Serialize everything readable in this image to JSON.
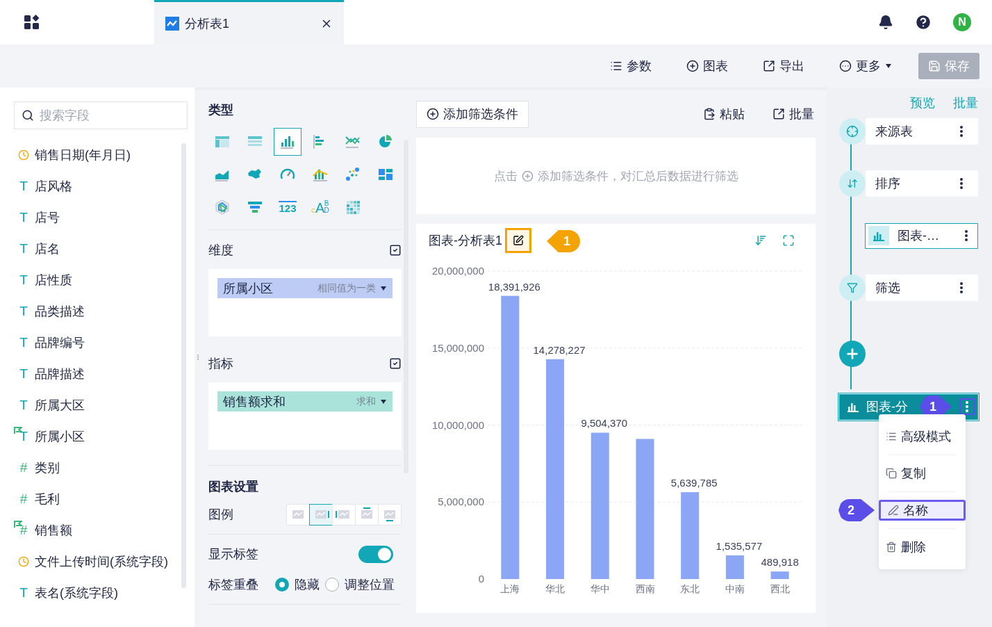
{
  "header": {
    "tab": {
      "title": "分析表1",
      "selected": true
    },
    "user_initial": "N"
  },
  "toolbar": {
    "buttons": [
      {
        "kind": "param",
        "label": "参数"
      },
      {
        "kind": "chart",
        "label": "图表"
      },
      {
        "kind": "export",
        "label": "导出"
      },
      {
        "kind": "more",
        "label": "更多"
      }
    ],
    "save": {
      "label": "保存",
      "disabled": true
    }
  },
  "fields": {
    "search_placeholder": "搜索字段",
    "items": [
      {
        "kind": "date",
        "name": "销售日期(年月日)",
        "flagged": false
      },
      {
        "kind": "text",
        "glyph": "T",
        "name": "店风格",
        "flagged": false
      },
      {
        "kind": "text",
        "glyph": "T",
        "name": "店号",
        "flagged": false
      },
      {
        "kind": "text",
        "glyph": "T",
        "name": "店名",
        "flagged": false
      },
      {
        "kind": "text",
        "glyph": "T",
        "name": "店性质",
        "flagged": false
      },
      {
        "kind": "text",
        "glyph": "T",
        "name": "品类描述",
        "flagged": false
      },
      {
        "kind": "text",
        "glyph": "T",
        "name": "品牌编号",
        "flagged": false
      },
      {
        "kind": "text",
        "glyph": "T",
        "name": "品牌描述",
        "flagged": false
      },
      {
        "kind": "text",
        "glyph": "T",
        "name": "所属大区",
        "flagged": false
      },
      {
        "kind": "text",
        "glyph": "T",
        "name": "所属小区",
        "flagged": true
      },
      {
        "kind": "number",
        "glyph": "#",
        "name": "类别",
        "flagged": false
      },
      {
        "kind": "number",
        "glyph": "#",
        "name": "毛利",
        "flagged": false
      },
      {
        "kind": "number",
        "glyph": "#",
        "name": "销售额",
        "flagged": true
      },
      {
        "kind": "date",
        "name": "文件上传时间(系统字段)",
        "flagged": false
      },
      {
        "kind": "text",
        "glyph": "T",
        "name": "表名(系统字段)",
        "flagged": false
      }
    ]
  },
  "config": {
    "type_title": "类型",
    "chart_types": [
      {
        "kind": "crosstab",
        "selected": false
      },
      {
        "kind": "table",
        "selected": false
      },
      {
        "kind": "bar",
        "selected": true
      },
      {
        "kind": "hbar",
        "selected": false
      },
      {
        "kind": "line",
        "selected": false
      },
      {
        "kind": "pie",
        "selected": false
      },
      {
        "kind": "area",
        "selected": false
      },
      {
        "kind": "map",
        "selected": false
      },
      {
        "kind": "gauge",
        "selected": false
      },
      {
        "kind": "combo",
        "selected": false
      },
      {
        "kind": "scatter",
        "selected": false
      },
      {
        "kind": "tiles",
        "selected": false
      },
      {
        "kind": "radar",
        "selected": false
      },
      {
        "kind": "funnel",
        "selected": false
      },
      {
        "kind": "number",
        "glyph": "123",
        "selected": false
      },
      {
        "kind": "wordcloud",
        "glyphs": [
          "C",
          "A",
          "B",
          "D"
        ],
        "selected": false
      },
      {
        "kind": "heatmap",
        "selected": false
      }
    ],
    "dimension": {
      "title": "维度",
      "fields": [
        {
          "name": "所属小区",
          "note": "相同值为一类"
        }
      ]
    },
    "measure": {
      "title": "指标",
      "fields": [
        {
          "name": "销售额求和",
          "note": "求和"
        }
      ]
    },
    "settings": {
      "title": "图表设置",
      "legend": {
        "label": "图例",
        "options": [
          {
            "kind": "none",
            "selected": false
          },
          {
            "kind": "right",
            "selected": true
          },
          {
            "kind": "left",
            "selected": false
          },
          {
            "kind": "top",
            "selected": false
          },
          {
            "kind": "bottom",
            "selected": false
          }
        ]
      },
      "show_labels": {
        "label": "显示标签",
        "on": true
      },
      "overlap": {
        "label": "标签重叠",
        "options": [
          {
            "label": "隐藏",
            "selected": true
          },
          {
            "label": "调整位置",
            "selected": false
          }
        ]
      }
    }
  },
  "filter": {
    "add": "添加筛选条件",
    "paste": "粘贴",
    "batch": "批量",
    "hint_before": "点击",
    "hint_link": "添加筛选条件，对汇总后数据进行筛选"
  },
  "chart": {
    "title": "图表-分析表1",
    "callout": "1",
    "chart_data": {
      "type": "bar",
      "categories": [
        "上海",
        "华北",
        "华中",
        "西南",
        "东北",
        "中南",
        "西北"
      ],
      "values": [
        18391926,
        14278227,
        9504370,
        9100000,
        5639785,
        1535577,
        489918
      ],
      "value_labels": [
        "18,391,926",
        "14,278,227",
        "9,504,370",
        null,
        "5,639,785",
        "1,535,577",
        "489,918"
      ],
      "grid": true,
      "ylim": [
        0,
        20000000
      ],
      "yticks": [
        {
          "value": 0,
          "label": "0"
        },
        {
          "value": 5000000,
          "label": "5,000,000"
        },
        {
          "value": 10000000,
          "label": "10,000,000"
        },
        {
          "value": 15000000,
          "label": "15,000,000"
        },
        {
          "value": 20000000,
          "label": "20,000,000"
        }
      ]
    }
  },
  "steps": {
    "preview": "预览",
    "batch": "批量",
    "nodes": [
      {
        "kind": "source",
        "label": "来源表"
      },
      {
        "kind": "sort",
        "label": "排序"
      },
      {
        "kind": "branch",
        "label": "图表-…"
      },
      {
        "kind": "filter",
        "label": "筛选"
      },
      {
        "kind": "add"
      },
      {
        "kind": "chart",
        "label": "图表-分",
        "selected": true,
        "callout": "1"
      }
    ]
  },
  "menu": {
    "items": [
      {
        "kind": "advanced",
        "label": "高级模式",
        "selected": false
      },
      {
        "kind": "copy",
        "label": "复制",
        "selected": false
      },
      {
        "kind": "rename",
        "label": "名称",
        "selected": true,
        "callout": "2"
      },
      {
        "kind": "delete",
        "label": "删除",
        "selected": false
      }
    ]
  }
}
